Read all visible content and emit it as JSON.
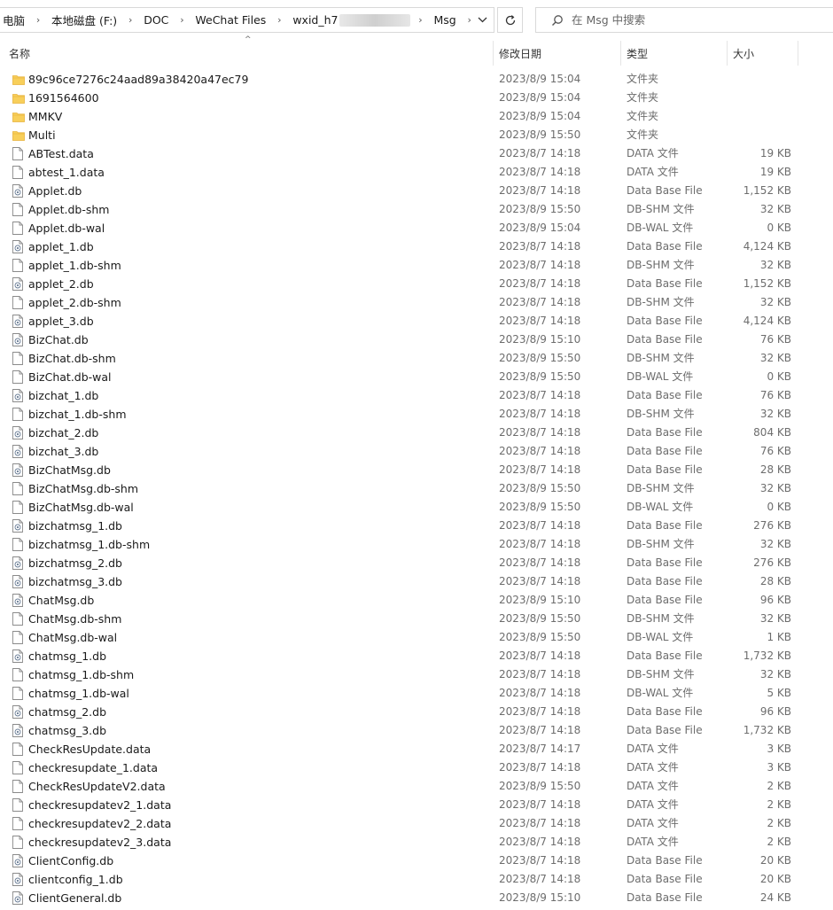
{
  "address": {
    "crumbs": [
      "电脑",
      "本地磁盘 (F:)",
      "DOC",
      "WeChat Files",
      "wxid_h7",
      "Msg"
    ]
  },
  "search": {
    "placeholder": "在 Msg 中搜索"
  },
  "columns": {
    "name": "名称",
    "date": "修改日期",
    "type": "类型",
    "size": "大小"
  },
  "files": [
    {
      "name": "89c96ce7276c24aad89a38420a47ec79",
      "date": "2023/8/9 15:04",
      "type": "文件夹",
      "size": "",
      "icon": "folder-icon"
    },
    {
      "name": "1691564600",
      "date": "2023/8/9 15:04",
      "type": "文件夹",
      "size": "",
      "icon": "folder-icon"
    },
    {
      "name": "MMKV",
      "date": "2023/8/9 15:04",
      "type": "文件夹",
      "size": "",
      "icon": "folder-icon"
    },
    {
      "name": "Multi",
      "date": "2023/8/9 15:50",
      "type": "文件夹",
      "size": "",
      "icon": "folder-icon"
    },
    {
      "name": "ABTest.data",
      "date": "2023/8/7 14:18",
      "type": "DATA 文件",
      "size": "19 KB",
      "icon": "file-icon"
    },
    {
      "name": "abtest_1.data",
      "date": "2023/8/7 14:18",
      "type": "DATA 文件",
      "size": "19 KB",
      "icon": "file-icon"
    },
    {
      "name": "Applet.db",
      "date": "2023/8/7 14:18",
      "type": "Data Base File",
      "size": "1,152 KB",
      "icon": "database-file-icon"
    },
    {
      "name": "Applet.db-shm",
      "date": "2023/8/9 15:50",
      "type": "DB-SHM 文件",
      "size": "32 KB",
      "icon": "file-icon"
    },
    {
      "name": "Applet.db-wal",
      "date": "2023/8/9 15:04",
      "type": "DB-WAL 文件",
      "size": "0 KB",
      "icon": "file-icon"
    },
    {
      "name": "applet_1.db",
      "date": "2023/8/7 14:18",
      "type": "Data Base File",
      "size": "4,124 KB",
      "icon": "database-file-icon"
    },
    {
      "name": "applet_1.db-shm",
      "date": "2023/8/7 14:18",
      "type": "DB-SHM 文件",
      "size": "32 KB",
      "icon": "file-icon"
    },
    {
      "name": "applet_2.db",
      "date": "2023/8/7 14:18",
      "type": "Data Base File",
      "size": "1,152 KB",
      "icon": "database-file-icon"
    },
    {
      "name": "applet_2.db-shm",
      "date": "2023/8/7 14:18",
      "type": "DB-SHM 文件",
      "size": "32 KB",
      "icon": "file-icon"
    },
    {
      "name": "applet_3.db",
      "date": "2023/8/7 14:18",
      "type": "Data Base File",
      "size": "4,124 KB",
      "icon": "database-file-icon"
    },
    {
      "name": "BizChat.db",
      "date": "2023/8/9 15:10",
      "type": "Data Base File",
      "size": "76 KB",
      "icon": "database-file-icon"
    },
    {
      "name": "BizChat.db-shm",
      "date": "2023/8/9 15:50",
      "type": "DB-SHM 文件",
      "size": "32 KB",
      "icon": "file-icon"
    },
    {
      "name": "BizChat.db-wal",
      "date": "2023/8/9 15:50",
      "type": "DB-WAL 文件",
      "size": "0 KB",
      "icon": "file-icon"
    },
    {
      "name": "bizchat_1.db",
      "date": "2023/8/7 14:18",
      "type": "Data Base File",
      "size": "76 KB",
      "icon": "database-file-icon"
    },
    {
      "name": "bizchat_1.db-shm",
      "date": "2023/8/7 14:18",
      "type": "DB-SHM 文件",
      "size": "32 KB",
      "icon": "file-icon"
    },
    {
      "name": "bizchat_2.db",
      "date": "2023/8/7 14:18",
      "type": "Data Base File",
      "size": "804 KB",
      "icon": "database-file-icon"
    },
    {
      "name": "bizchat_3.db",
      "date": "2023/8/7 14:18",
      "type": "Data Base File",
      "size": "76 KB",
      "icon": "database-file-icon"
    },
    {
      "name": "BizChatMsg.db",
      "date": "2023/8/7 14:18",
      "type": "Data Base File",
      "size": "28 KB",
      "icon": "database-file-icon"
    },
    {
      "name": "BizChatMsg.db-shm",
      "date": "2023/8/9 15:50",
      "type": "DB-SHM 文件",
      "size": "32 KB",
      "icon": "file-icon"
    },
    {
      "name": "BizChatMsg.db-wal",
      "date": "2023/8/9 15:50",
      "type": "DB-WAL 文件",
      "size": "0 KB",
      "icon": "file-icon"
    },
    {
      "name": "bizchatmsg_1.db",
      "date": "2023/8/7 14:18",
      "type": "Data Base File",
      "size": "276 KB",
      "icon": "database-file-icon"
    },
    {
      "name": "bizchatmsg_1.db-shm",
      "date": "2023/8/7 14:18",
      "type": "DB-SHM 文件",
      "size": "32 KB",
      "icon": "file-icon"
    },
    {
      "name": "bizchatmsg_2.db",
      "date": "2023/8/7 14:18",
      "type": "Data Base File",
      "size": "276 KB",
      "icon": "database-file-icon"
    },
    {
      "name": "bizchatmsg_3.db",
      "date": "2023/8/7 14:18",
      "type": "Data Base File",
      "size": "28 KB",
      "icon": "database-file-icon"
    },
    {
      "name": "ChatMsg.db",
      "date": "2023/8/9 15:10",
      "type": "Data Base File",
      "size": "96 KB",
      "icon": "database-file-icon"
    },
    {
      "name": "ChatMsg.db-shm",
      "date": "2023/8/9 15:50",
      "type": "DB-SHM 文件",
      "size": "32 KB",
      "icon": "file-icon"
    },
    {
      "name": "ChatMsg.db-wal",
      "date": "2023/8/9 15:50",
      "type": "DB-WAL 文件",
      "size": "1 KB",
      "icon": "file-icon"
    },
    {
      "name": "chatmsg_1.db",
      "date": "2023/8/7 14:18",
      "type": "Data Base File",
      "size": "1,732 KB",
      "icon": "database-file-icon"
    },
    {
      "name": "chatmsg_1.db-shm",
      "date": "2023/8/7 14:18",
      "type": "DB-SHM 文件",
      "size": "32 KB",
      "icon": "file-icon"
    },
    {
      "name": "chatmsg_1.db-wal",
      "date": "2023/8/7 14:18",
      "type": "DB-WAL 文件",
      "size": "5 KB",
      "icon": "file-icon"
    },
    {
      "name": "chatmsg_2.db",
      "date": "2023/8/7 14:18",
      "type": "Data Base File",
      "size": "96 KB",
      "icon": "database-file-icon"
    },
    {
      "name": "chatmsg_3.db",
      "date": "2023/8/7 14:18",
      "type": "Data Base File",
      "size": "1,732 KB",
      "icon": "database-file-icon"
    },
    {
      "name": "CheckResUpdate.data",
      "date": "2023/8/7 14:17",
      "type": "DATA 文件",
      "size": "3 KB",
      "icon": "file-icon"
    },
    {
      "name": "checkresupdate_1.data",
      "date": "2023/8/7 14:18",
      "type": "DATA 文件",
      "size": "3 KB",
      "icon": "file-icon"
    },
    {
      "name": "CheckResUpdateV2.data",
      "date": "2023/8/9 15:50",
      "type": "DATA 文件",
      "size": "2 KB",
      "icon": "file-icon"
    },
    {
      "name": "checkresupdatev2_1.data",
      "date": "2023/8/7 14:18",
      "type": "DATA 文件",
      "size": "2 KB",
      "icon": "file-icon"
    },
    {
      "name": "checkresupdatev2_2.data",
      "date": "2023/8/7 14:18",
      "type": "DATA 文件",
      "size": "2 KB",
      "icon": "file-icon"
    },
    {
      "name": "checkresupdatev2_3.data",
      "date": "2023/8/7 14:18",
      "type": "DATA 文件",
      "size": "2 KB",
      "icon": "file-icon"
    },
    {
      "name": "ClientConfig.db",
      "date": "2023/8/7 14:18",
      "type": "Data Base File",
      "size": "20 KB",
      "icon": "database-file-icon"
    },
    {
      "name": "clientconfig_1.db",
      "date": "2023/8/7 14:18",
      "type": "Data Base File",
      "size": "20 KB",
      "icon": "database-file-icon"
    },
    {
      "name": "ClientGeneral.db",
      "date": "2023/8/9 15:10",
      "type": "Data Base File",
      "size": "24 KB",
      "icon": "database-file-icon"
    }
  ],
  "colors": {
    "folder": "#f8cf5a",
    "folder_dark": "#e8b33c",
    "hover": "#e5f3ff",
    "muted_text": "#6d6d6d"
  }
}
